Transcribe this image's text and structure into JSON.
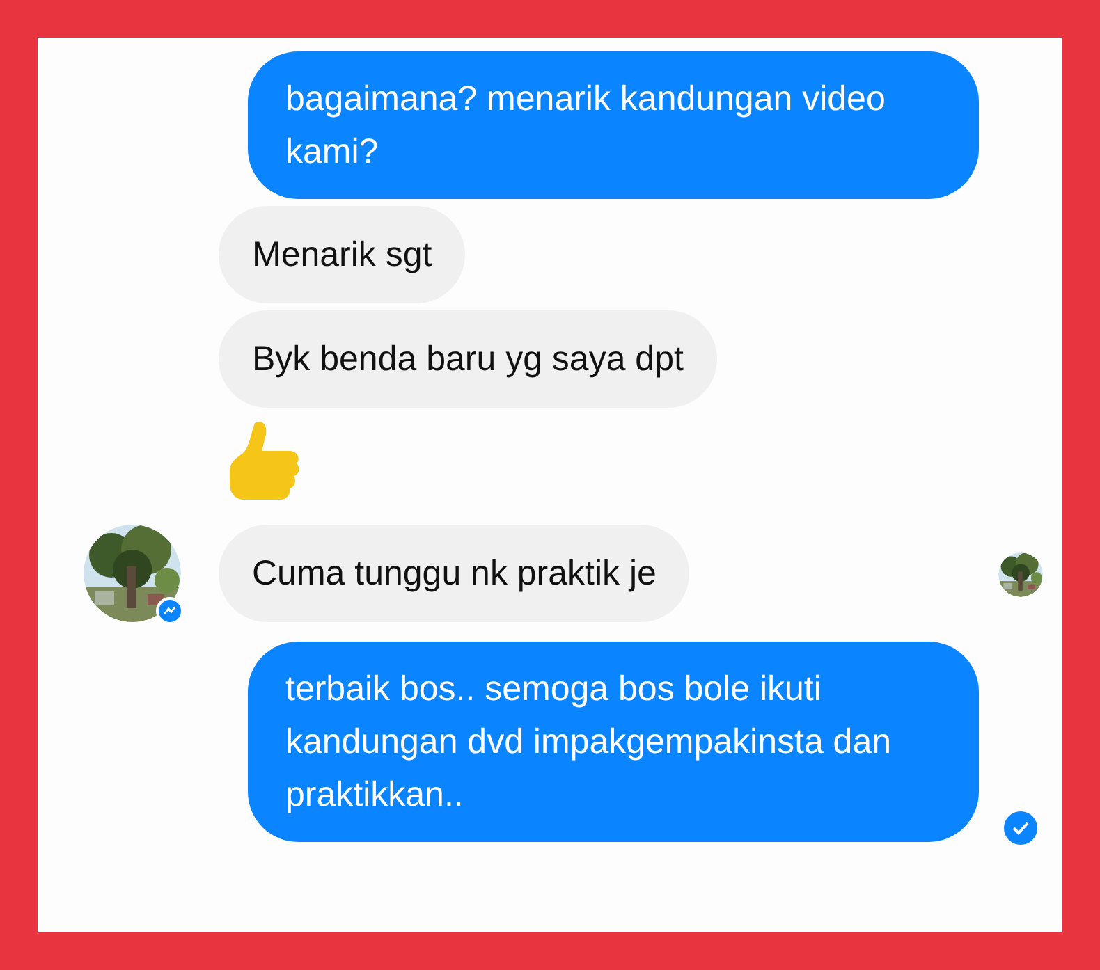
{
  "messages": [
    {
      "kind": "sent",
      "text": "bagaimana? menarik kandungan video kami?",
      "avatar": false,
      "seen_marker": false,
      "delivered": false
    },
    {
      "kind": "received",
      "text": "Menarik sgt",
      "avatar": false,
      "seen_marker": false,
      "delivered": false
    },
    {
      "kind": "received",
      "text": "Byk benda baru yg saya dpt",
      "avatar": false,
      "seen_marker": false,
      "delivered": false
    },
    {
      "kind": "like",
      "avatar": false,
      "seen_marker": false,
      "delivered": false
    },
    {
      "kind": "received",
      "text": "Cuma tunggu nk praktik je",
      "avatar": true,
      "seen_marker": true,
      "delivered": false
    },
    {
      "kind": "sent",
      "text": "terbaik bos.. semoga bos bole ikuti kandungan dvd impakgempakinsta dan praktikkan..",
      "avatar": false,
      "seen_marker": false,
      "delivered": true
    }
  ]
}
